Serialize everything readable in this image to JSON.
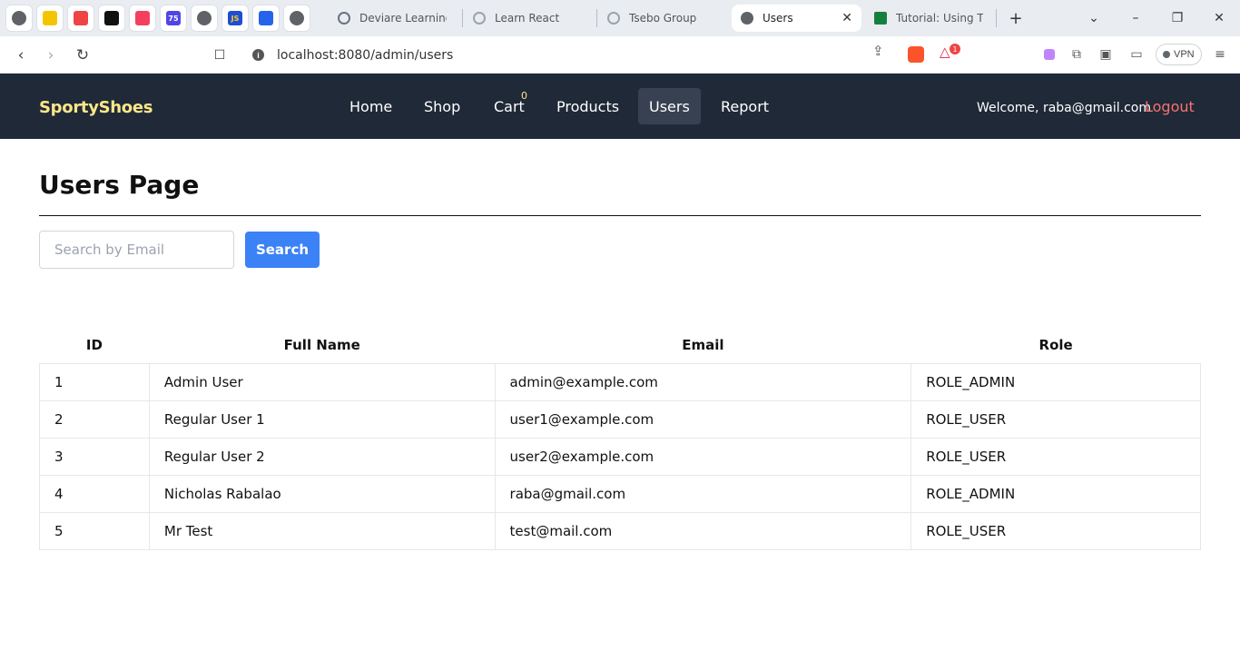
{
  "browser": {
    "tabs": [
      {
        "label": "Deviare Learning Pl",
        "active": false
      },
      {
        "label": "Learn React",
        "active": false
      },
      {
        "label": "Tsebo Group",
        "active": false
      },
      {
        "label": "Users",
        "active": true
      },
      {
        "label": "Tutorial: Using Thy",
        "active": false
      }
    ],
    "pinned_icons": [
      "globe-icon",
      "yellow-app-icon",
      "laravel-icon",
      "crown-icon",
      "p-icon",
      "75-icon",
      "globe-icon",
      "js-icon",
      "powerautomate-icon",
      "globe-icon"
    ],
    "pinned_text": {
      "seventy_five": "75",
      "js": "JS"
    },
    "url": "localhost:8080/admin/users",
    "notification_count": "1",
    "vpn_label": "VPN",
    "colors": {
      "tabstrip": "#e9ecf1",
      "active_tab": "#ffffff"
    }
  },
  "app": {
    "brand": "SportyShoes",
    "nav": {
      "home": "Home",
      "shop": "Shop",
      "cart": "Cart",
      "cart_count": "0",
      "products": "Products",
      "users": "Users",
      "report": "Report"
    },
    "welcome": "Welcome, raba@gmail.com",
    "logout": "Logout",
    "colors": {
      "navbar": "#1f2937",
      "brand": "#fde68a",
      "logout": "#f87171",
      "accent": "#3b82f6"
    }
  },
  "page": {
    "title": "Users Page",
    "search": {
      "placeholder": "Search by Email",
      "value": "",
      "button": "Search"
    },
    "table": {
      "headers": {
        "id": "ID",
        "name": "Full Name",
        "email": "Email",
        "role": "Role"
      },
      "rows": [
        {
          "id": "1",
          "name": "Admin User",
          "email": "admin@example.com",
          "role": "ROLE_ADMIN"
        },
        {
          "id": "2",
          "name": "Regular User 1",
          "email": "user1@example.com",
          "role": "ROLE_USER"
        },
        {
          "id": "3",
          "name": "Regular User 2",
          "email": "user2@example.com",
          "role": "ROLE_USER"
        },
        {
          "id": "4",
          "name": "Nicholas Rabalao",
          "email": "raba@gmail.com",
          "role": "ROLE_ADMIN"
        },
        {
          "id": "5",
          "name": "Mr Test",
          "email": "test@mail.com",
          "role": "ROLE_USER"
        }
      ]
    }
  }
}
